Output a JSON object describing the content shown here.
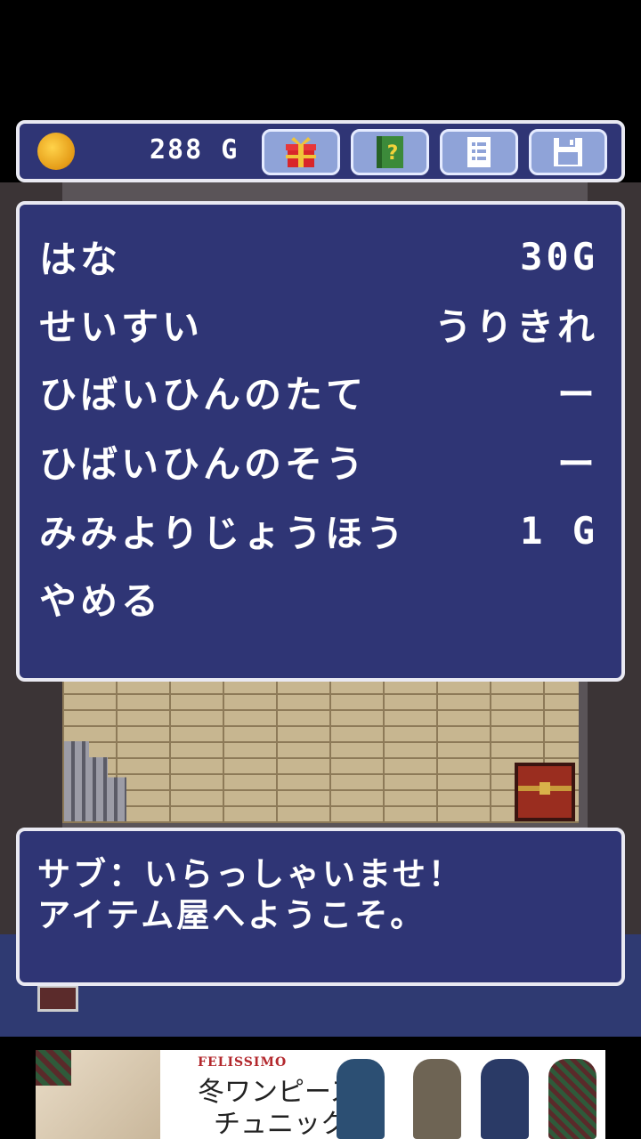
{
  "hud": {
    "gold_amount": "288 G",
    "buttons": [
      {
        "icon": "gift-icon"
      },
      {
        "icon": "help-book-icon"
      },
      {
        "icon": "list-icon"
      },
      {
        "icon": "save-disk-icon"
      }
    ]
  },
  "menu": {
    "items": [
      {
        "label": "はな",
        "price": "30G"
      },
      {
        "label": "せいすい",
        "price": "うりきれ"
      },
      {
        "label": "ひばいひんのたて",
        "price": "ー"
      },
      {
        "label": "ひばいひんのそう",
        "price": "ー"
      },
      {
        "label": "みみよりじょうほう",
        "price": "1 G"
      },
      {
        "label": "やめる",
        "price": ""
      }
    ]
  },
  "dialog": {
    "line1": "サブ：いらっしゃいませ！",
    "line2": "アイテム屋へようこそ。"
  },
  "ad": {
    "brand": "FELISSIMO",
    "line1": "冬ワンピース",
    "line2": "チュニック"
  },
  "colors": {
    "window_bg": "#2f3575",
    "window_border": "#e9e9f2",
    "coin": "#f2b11f",
    "button_bg": "#8fa3d8"
  }
}
